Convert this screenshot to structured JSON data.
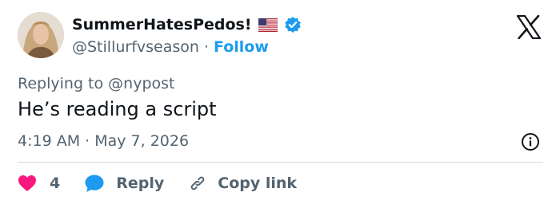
{
  "author": {
    "display_name": "SummerHatesPedos!",
    "handle": "@Stillurfvseason",
    "separator": "·",
    "follow_label": "Follow",
    "flag_icon": "us-flag-icon",
    "verified_icon": "verified-badge-icon"
  },
  "tweet": {
    "replying_to": "Replying to @nypost",
    "text": "He’s reading a script",
    "timestamp": "4:19 AM · May 7, 2026"
  },
  "actions": {
    "like_count": "4",
    "reply_label": "Reply",
    "copy_link_label": "Copy link"
  },
  "colors": {
    "accent": "#1d9bf0",
    "like": "#f91880",
    "text": "#0f1419",
    "secondary": "#536471"
  }
}
